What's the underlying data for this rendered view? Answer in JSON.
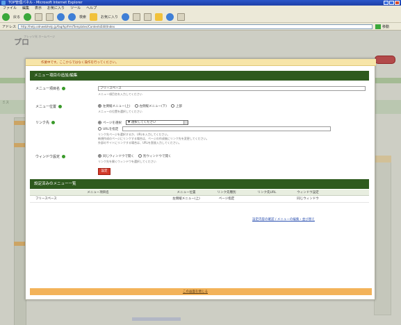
{
  "browser": {
    "title": "TOP管理パネル - Microsoft Internet Explorer",
    "menu": [
      "ファイル",
      "編集",
      "表示",
      "お気に入り",
      "ツール",
      "ヘルプ"
    ],
    "toolbar": {
      "back": "戻る",
      "search": "検索",
      "favorites": "お気に入り"
    },
    "address_label": "アドレス",
    "address_value": "http://help.odnwebhelp.jp/faq/hp/frm/Templates/ContentsEdit/Index",
    "go_label": "移動"
  },
  "background": {
    "site_title": "プロ",
    "site_sub": "フレッツ光 ホームページ",
    "left_label": "ミス"
  },
  "modal": {
    "top_note": "作業中です。ここからではなく操作を行ってください。",
    "section1_title": "メニュー項目の追加/編集",
    "form": {
      "menu_name_label": "メニュー項目名",
      "menu_name_value": "フリースペース",
      "menu_name_hint": "メニュー項目名を入力してください",
      "menu_pos_label": "メニュー位置",
      "menu_pos_options": [
        "左側縦メニュー(上)",
        "左側縦メニュー(下)",
        "上部"
      ],
      "menu_pos_selected": 0,
      "menu_pos_hint": "メニューの位置を選択してください",
      "link_label": "リンク先",
      "link_options": [
        "ページを選択",
        "URLを指定"
      ],
      "link_select_value": "▼ 選択してください",
      "link_hint_1": "リンク先ページを選択するか、URLを入力してください。",
      "link_hint_2": "新規作成のページにリンクする場合は、ページの作成後にリンク先を変更してください。",
      "link_hint_3": "外部のサイトにリンクする場合は、URLを直接入力してください。",
      "window_label": "ウィンドウ設定",
      "window_options": [
        "同じウィンドウで開く",
        "別ウィンドウで開く"
      ],
      "window_hint": "リンク先を開くウィンドウを選択してください",
      "submit_label": "設定"
    },
    "section2_title": "設定済みのメニュー一覧",
    "table": {
      "headers": [
        "メニュー項目名",
        "メニュー位置",
        "リンク先種別",
        "リンク先URL",
        "ウィンドウ設定"
      ],
      "rows": [
        [
          "フリースペース",
          "左側縦メニュー(上)",
          "ページ指定",
          "",
          "同じウィンドウ"
        ]
      ]
    },
    "table_link": "設定内容の確認 / メニューの編集・並び替え",
    "close_label": "この画面を閉じる"
  },
  "colors": {
    "section_header": "#2e5a1e",
    "top_note_bg": "#f7e5a8",
    "footer_bg": "#f3b35a",
    "submit_bg": "#d23a2a"
  }
}
